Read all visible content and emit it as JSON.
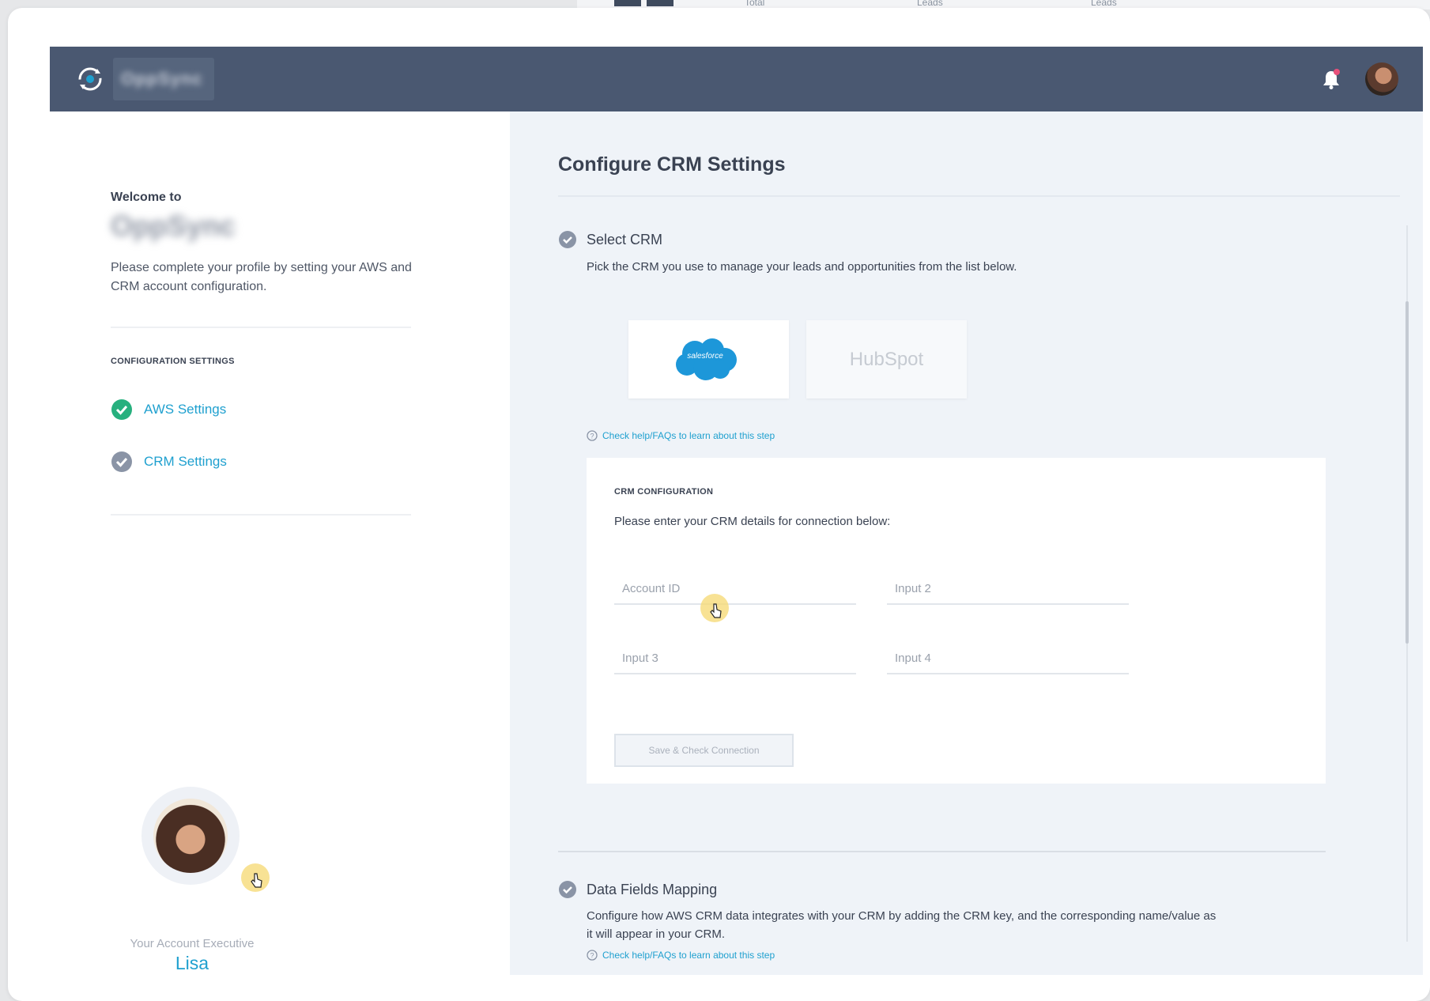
{
  "background": {
    "items": [
      "Total",
      "Leads",
      "Leads"
    ]
  },
  "header": {
    "brand": "OppSync"
  },
  "sidebar": {
    "welcome": "Welcome to",
    "app_name": "OppSync",
    "intro": "Please complete your profile by setting your AWS and CRM account configuration.",
    "section_title": "CONFIGURATION SETTINGS",
    "items": [
      {
        "label": "AWS Settings",
        "status": "complete"
      },
      {
        "label": "CRM Settings",
        "status": "pending"
      }
    ],
    "executive_label": "Your Account Executive",
    "executive_name": "Lisa"
  },
  "main": {
    "title": "Configure CRM Settings",
    "step1": {
      "title": "Select CRM",
      "description": "Pick the CRM you use to manage your leads and opportunities from the list below.",
      "options": [
        {
          "label": "salesforce",
          "selected": true
        },
        {
          "label": "HubSpot",
          "selected": false
        }
      ],
      "help": "Check help/FAQs to learn about this step"
    },
    "config": {
      "heading": "CRM CONFIGURATION",
      "description": "Please enter your CRM details for connection below:",
      "fields": [
        {
          "placeholder": "Account ID",
          "value": ""
        },
        {
          "placeholder": "Input 2",
          "value": ""
        },
        {
          "placeholder": "Input 3",
          "value": ""
        },
        {
          "placeholder": "Input 4",
          "value": ""
        }
      ],
      "button": "Save & Check Connection"
    },
    "step2": {
      "title": "Data Fields Mapping",
      "description_line1": "Configure how AWS CRM data integrates with your CRM by adding the CRM key, and the corresponding name/value as",
      "description_line2": "it will appear in your CRM.",
      "help": "Check help/FAQs to learn about this step"
    }
  },
  "colors": {
    "topbar": "#4a5871",
    "accent": "#1fa0cf",
    "success": "#27b07e",
    "panel": "#eff3f8"
  },
  "icons": [
    "sync-logo-icon",
    "bell-icon",
    "check-circle-icon",
    "help-circle-icon",
    "salesforce-logo",
    "cursor-pointer-icon"
  ]
}
